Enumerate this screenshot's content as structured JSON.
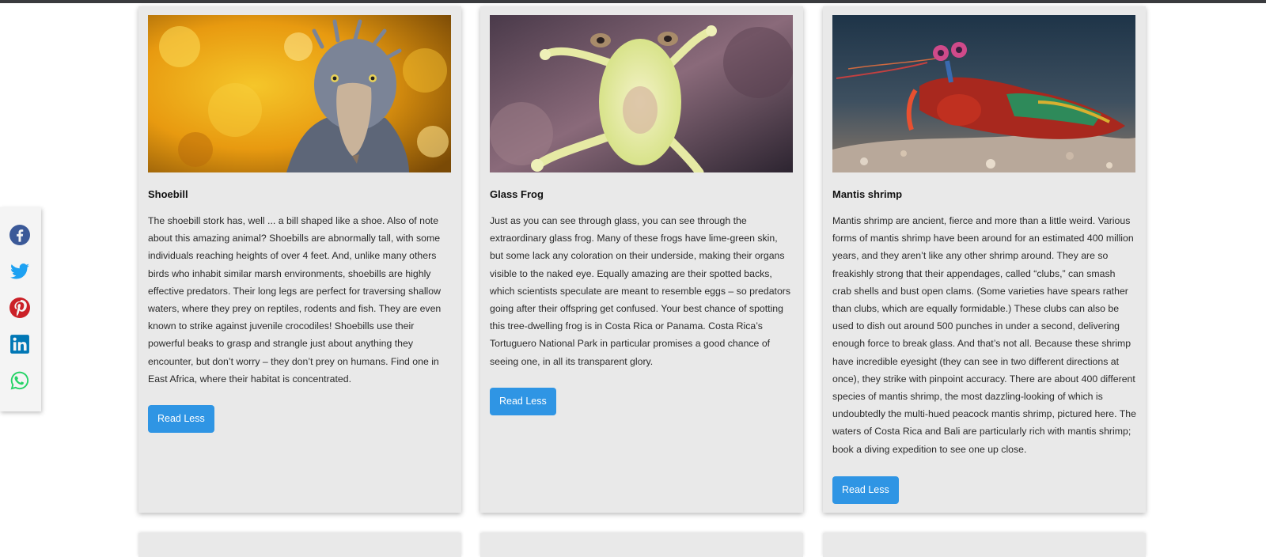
{
  "share": {
    "items": [
      {
        "name": "facebook",
        "icon": "facebook-icon",
        "color": "#3b5998"
      },
      {
        "name": "twitter",
        "icon": "twitter-icon",
        "color": "#1da1f2"
      },
      {
        "name": "pinterest",
        "icon": "pinterest-icon",
        "color": "#cb2027"
      },
      {
        "name": "linkedin",
        "icon": "linkedin-icon",
        "color": "#0077b5"
      },
      {
        "name": "whatsapp",
        "icon": "whatsapp-icon",
        "color": "#25d366"
      }
    ]
  },
  "cards": [
    {
      "title": "Shoebill",
      "text": "The shoebill stork has, well ... a bill shaped like a shoe. Also of note about this amazing animal? Shoebills are abnormally tall, with some individuals reaching heights of over 4 feet. And, unlike many others birds who inhabit similar marsh environments, shoebills are highly effective predators. Their long legs are perfect for traversing shallow waters, where they prey on reptiles, rodents and fish. They are even known to strike against juvenile crocodiles! Shoebills use their powerful beaks to grasp and strangle just about anything they encounter, but don’t worry – they don’t prey on humans. Find one in East Africa, where their habitat is concentrated.",
      "button_label": "Read Less"
    },
    {
      "title": "Glass Frog",
      "text": "Just as you can see through glass, you can see through the extraordinary glass frog. Many of these frogs have lime-green skin, but some lack any coloration on their underside, making their organs visible to the naked eye. Equally amazing are their spotted backs, which scientists speculate are meant to resemble eggs – so predators going after their offspring get confused. Your best chance of spotting this tree-dwelling frog is in Costa Rica or Panama. Costa Rica’s Tortuguero National Park in particular promises a good chance of seeing one, in all its transparent glory.",
      "button_label": "Read Less"
    },
    {
      "title": "Mantis shrimp",
      "text": "Mantis shrimp are ancient, fierce and more than a little weird. Various forms of mantis shrimp have been around for an estimated 400 million years, and they aren’t like any other shrimp around. They are so freakishly strong that their appendages, called “clubs,” can smash crab shells and bust open clams. (Some varieties have spears rather than clubs, which are equally formidable.) These clubs can also be used to dish out around 500 punches in under a second, delivering enough force to break glass. And that’s not all. Because these shrimp have incredible eyesight (they can see in two different directions at once), they strike with pinpoint accuracy. There are about 400 different species of mantis shrimp, the most dazzling-looking of which is undoubtedly the multi-hued peacock mantis shrimp, pictured here. The waters of Costa Rica and Bali are particularly rich with mantis shrimp; book a diving expedition to see one up close.",
      "button_label": "Read Less"
    }
  ],
  "colors": {
    "button": "#2f95e4",
    "card_bg": "#e9e9e9",
    "topbar": "#3a3b3e"
  }
}
